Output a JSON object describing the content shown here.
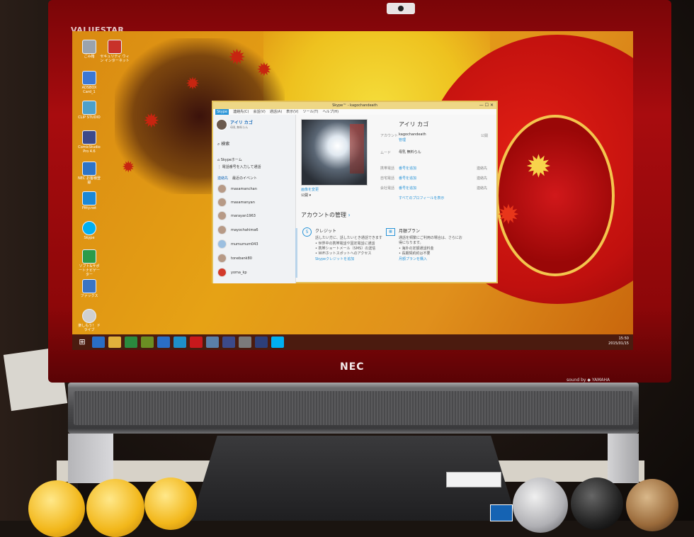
{
  "monitor": {
    "brand_top": "VALUESTAR",
    "brand_bottom": "NEC",
    "sound_badge": "sound by ◆ YAMAHA"
  },
  "desktop": {
    "icons": [
      {
        "label": "ごみ箱",
        "color": "#9aa3ad"
      },
      {
        "label": "ADSBOX Card_1",
        "color": "#3b78d4"
      },
      {
        "label": "CLIP STUDIO",
        "color": "#4ea0c9"
      },
      {
        "label": "ComicStudio Pro 4.6",
        "color": "#3c4a8a"
      },
      {
        "label": "NEC お客様登録",
        "color": "#2e74c7"
      },
      {
        "label": "Pitty.net",
        "color": "#1b88d6"
      },
      {
        "label": "Skype",
        "color": "#00aff0"
      },
      {
        "label": "ソフト&サポートナビゲーター",
        "color": "#2b9b4a"
      },
      {
        "label": "ファックス",
        "color": "#3a75c4"
      },
      {
        "label": "楽しもう！ ドライブ",
        "color": "#d0d0d0"
      }
    ],
    "top_icon_label": "セキュリティ ウィン インターネット",
    "tray": {
      "time": "15:50",
      "date": "2015/01/15"
    }
  },
  "skype": {
    "title": "Skype™ - kagochandeath",
    "menu": [
      "Skype",
      "連絡先(C)",
      "会話(V)",
      "通話(A)",
      "表示(V)",
      "ツール(T)",
      "ヘルプ(H)"
    ],
    "user_name": "アイリ カゴ",
    "user_mood": "母乳 無料らん",
    "search_label": "検索",
    "home_label": "Skypeホーム",
    "call_phone_label": "電話番号を入力して通話",
    "tabs": [
      "連絡先",
      "最近のイベント"
    ],
    "contacts": [
      "masamanchan",
      "masamanyan",
      "marayan1963",
      "mayochahima6",
      "mumumum043",
      "tonebank80",
      "yoma_kp"
    ],
    "profile": {
      "display_name": "アイリ カゴ",
      "account_label": "アカウント",
      "account_value": "kagochandeath",
      "account_sub": "管理",
      "account_public": "公開",
      "mood_label": "ムード",
      "mood_value": "母乳 無料らん",
      "rows": [
        {
          "label": "携帯電話",
          "action": "番号を追加",
          "status": "連絡先"
        },
        {
          "label": "自宅電話",
          "action": "番号を追加",
          "status": "連絡先"
        },
        {
          "label": "会社電話",
          "action": "番号を追加",
          "status": "連絡先"
        }
      ],
      "show_all": "すべてのプロフィールを表示",
      "change_photo": "画像を変更",
      "visibility": "公開 ▾"
    },
    "account_section": {
      "heading": "アカウントの管理",
      "credit_title": "クレジット",
      "credit_lines": [
        "話したい方に、話したいとき通話できます",
        "• 世界中の携帯電話や固定電話に通話",
        "• 携帯ショートメール（SMS）の送信",
        "• WiFiホットスポットへのアクセス"
      ],
      "credit_link": "Skypeクレジットを追加",
      "plan_title": "月額プラン",
      "plan_lines": [
        "通話を頻繁にご利用の場合は、さらにお",
        "得になります。",
        "• 海外の定額通話料金",
        "• 長期契約約は不要"
      ],
      "plan_link": "月額プランを購入"
    }
  }
}
